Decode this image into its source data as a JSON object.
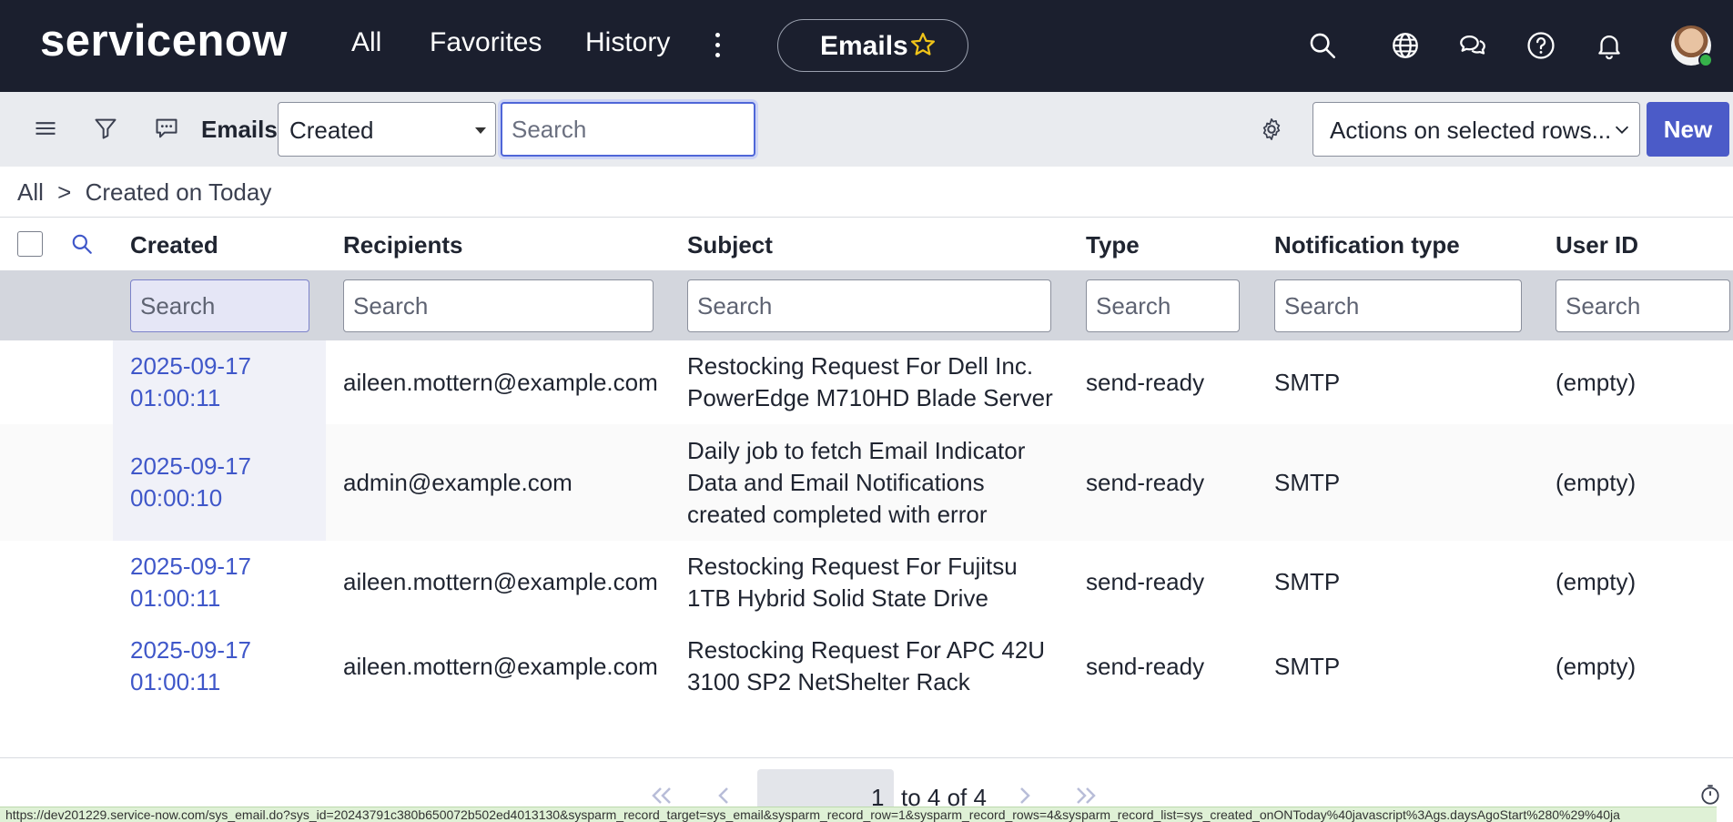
{
  "header": {
    "logo": "servicenow",
    "nav": [
      {
        "label": "All"
      },
      {
        "label": "Favorites"
      },
      {
        "label": "History"
      }
    ],
    "context_title": "Emails",
    "icons": [
      "search-icon",
      "globe-icon",
      "chat-icon",
      "help-icon",
      "bell-icon"
    ]
  },
  "toolbar": {
    "title": "Emails",
    "field_selected": "Created",
    "search_placeholder": "Search",
    "actions_selected": "Actions on selected rows...",
    "new_label": "New"
  },
  "breadcrumb": {
    "root": "All",
    "separator": ">",
    "filter": "Created on Today"
  },
  "table": {
    "columns": [
      "Created",
      "Recipients",
      "Subject",
      "Type",
      "Notification type",
      "User ID"
    ],
    "search_placeholder": "Search",
    "rows": [
      {
        "created_date": "2025-09-17",
        "created_time": "01:00:11",
        "recipients": "aileen.mottern@example.com",
        "subject_lines": [
          "Restocking Request For Dell Inc.",
          "PowerEdge M710HD Blade Server"
        ],
        "type": "send-ready",
        "notification_type": "SMTP",
        "user_id": "(empty)"
      },
      {
        "created_date": "2025-09-17",
        "created_time": "00:00:10",
        "recipients": "admin@example.com",
        "subject_lines": [
          "Daily job to fetch Email Indicator",
          "Data and Email Notifications",
          "created completed with error"
        ],
        "type": "send-ready",
        "notification_type": "SMTP",
        "user_id": "(empty)"
      },
      {
        "created_date": "2025-09-17",
        "created_time": "01:00:11",
        "recipients": "aileen.mottern@example.com",
        "subject_lines": [
          "Restocking Request For Fujitsu",
          "1TB Hybrid Solid State Drive"
        ],
        "type": "send-ready",
        "notification_type": "SMTP",
        "user_id": "(empty)"
      },
      {
        "created_date": "2025-09-17",
        "created_time": "01:00:11",
        "recipients": "aileen.mottern@example.com",
        "subject_lines": [
          "Restocking Request For APC 42U",
          "3100 SP2 NetShelter Rack"
        ],
        "type": "send-ready",
        "notification_type": "SMTP",
        "user_id": "(empty)"
      }
    ]
  },
  "pagination": {
    "current": "1",
    "range_text": "to 4 of 4"
  },
  "status_bar_url": "https://dev201229.service-now.com/sys_email.do?sys_id=20243791c380b650072b502ed4013130&sysparm_record_target=sys_email&sysparm_record_row=1&sysparm_record_rows=4&sysparm_record_list=sys_created_onONToday%40javascript%3Ags.daysAgoStart%280%29%40ja",
  "colors": {
    "header_bg": "#1b1f2e",
    "accent": "#4b5bc8",
    "link": "#3f57c9",
    "toolbar_bg": "#e9ebef"
  }
}
